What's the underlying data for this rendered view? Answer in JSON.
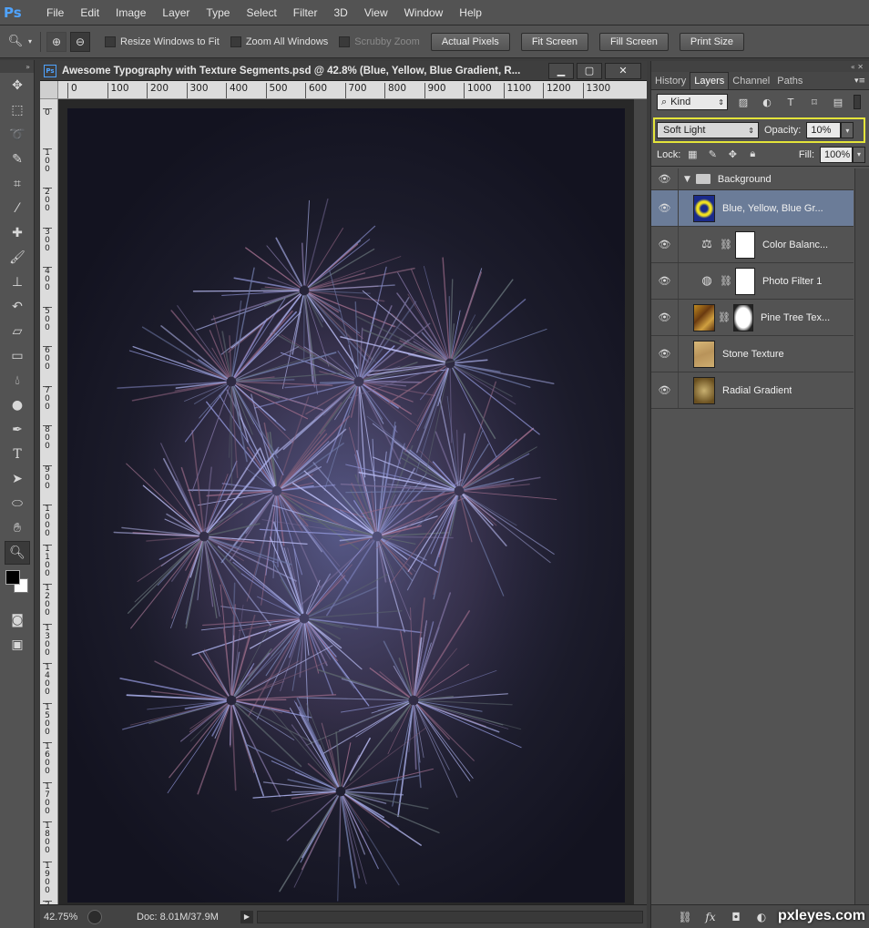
{
  "app": {
    "logo": "Ps",
    "menu": [
      "File",
      "Edit",
      "Image",
      "Layer",
      "Type",
      "Select",
      "Filter",
      "3D",
      "View",
      "Window",
      "Help"
    ]
  },
  "options": {
    "resize_windows": "Resize Windows to Fit",
    "zoom_all": "Zoom All Windows",
    "scrubby": "Scrubby Zoom",
    "actual_pixels": "Actual Pixels",
    "fit_screen": "Fit Screen",
    "fill_screen": "Fill Screen",
    "print_size": "Print Size"
  },
  "document": {
    "title": "Awesome Typography with Texture Segments.psd @ 42.8% (Blue, Yellow, Blue Gradient, R...",
    "hruler": [
      "0",
      "100",
      "200",
      "300",
      "400",
      "500",
      "600",
      "700",
      "800",
      "900",
      "1000",
      "1100",
      "1200",
      "1300"
    ],
    "vruler": [
      "0",
      "100",
      "200",
      "300",
      "400",
      "500",
      "600",
      "700",
      "800",
      "900",
      "1000",
      "1100",
      "1200",
      "1300",
      "1400",
      "1500",
      "1600",
      "1700",
      "1800",
      "1900",
      "2000"
    ],
    "zoom": "42.75%",
    "doc_size": "Doc: 8.01M/37.9M"
  },
  "panel": {
    "tabs": [
      "History",
      "Layers",
      "Channel",
      "Paths"
    ],
    "active_tab": "Layers",
    "kind": "Kind",
    "blend_mode": "Soft Light",
    "opacity_label": "Opacity:",
    "opacity": "10%",
    "lock_label": "Lock:",
    "fill_label": "Fill:",
    "fill": "100%",
    "layers": [
      {
        "name": "Background",
        "type": "group"
      },
      {
        "name": "Blue, Yellow, Blue Gr...",
        "type": "gradient",
        "selected": true
      },
      {
        "name": "Color Balanc...",
        "type": "adjustment",
        "icon": "balance-icon"
      },
      {
        "name": "Photo Filter 1",
        "type": "adjustment",
        "icon": "photo-filter-icon"
      },
      {
        "name": "Pine Tree Tex...",
        "type": "image-mask"
      },
      {
        "name": "Stone Texture",
        "type": "image"
      },
      {
        "name": "Radial Gradient",
        "type": "image"
      }
    ]
  },
  "watermark": "pxleyes.com"
}
